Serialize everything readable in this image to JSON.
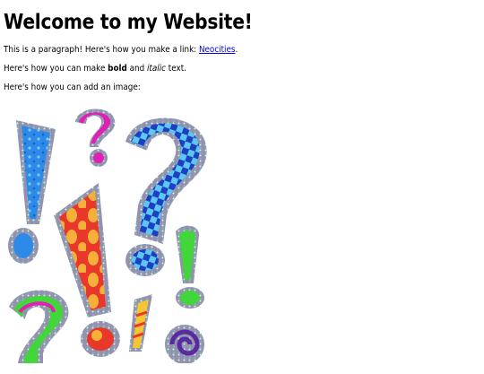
{
  "page": {
    "heading": "Welcome to my Website!",
    "para1_prefix": "This is a paragraph! Here's how you make a link: ",
    "link_label": "Neocities",
    "para1_suffix": ".",
    "para2_prefix": "Here's how you can make ",
    "bold_text": "bold",
    "para2_middle": " and ",
    "italic_text": "italic",
    "para2_suffix": " text.",
    "para3": "Here's how you can add an image:"
  },
  "image": {
    "subject": "glittery-punctuation-clipart",
    "colors": {
      "blue": "#2d8ae8",
      "red": "#e63a2c",
      "yellow": "#f7c531",
      "magenta": "#e020b5",
      "green": "#42d63a",
      "purple": "#6a2ea8",
      "glitter": "#9aa2b4"
    }
  }
}
